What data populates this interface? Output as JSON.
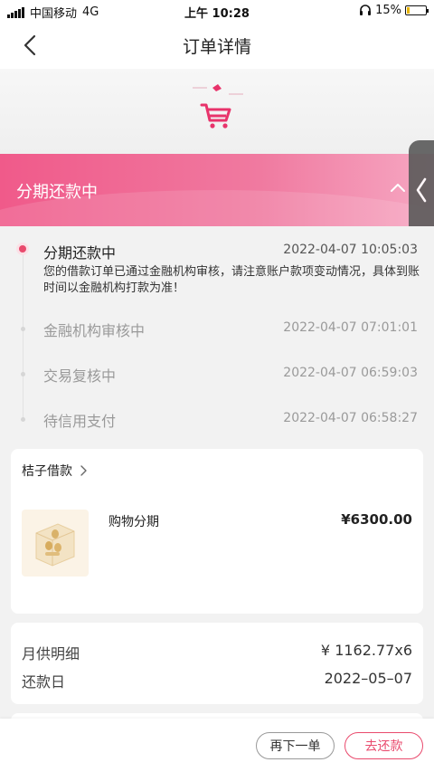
{
  "status_bar": {
    "carrier": "中国移动",
    "network": "4G",
    "time": "上午 10:28",
    "battery_percent": "15%",
    "battery_level": 0.15
  },
  "nav": {
    "title": "订单详情",
    "back_icon": "chevron-left-icon"
  },
  "hero": {
    "icon": "shopping-cart-icon",
    "accent_color": "#e8336b"
  },
  "status_banner": {
    "label": "分期还款中",
    "toggle_icon": "chevron-up-icon",
    "gradient": [
      "#f05a8a",
      "#f6a7c2"
    ]
  },
  "side_handle": {
    "icon": "chevron-left-icon"
  },
  "timeline": {
    "current": {
      "title": "分期还款中",
      "time": "2022-04-07 10:05:03",
      "description": "您的借款订单已通过金融机构审核，请注意账户款项变动情况，具体到账时间以金融机构打款为准！"
    },
    "history": [
      {
        "title": "金融机构审核中",
        "time": "2022-04-07 07:01:01"
      },
      {
        "title": "交易复核中",
        "time": "2022-04-07 06:59:03"
      },
      {
        "title": "待信用支付",
        "time": "2022-04-07 06:58:27"
      }
    ]
  },
  "product_card": {
    "merchant": "桔子借款",
    "merchant_icon": "chevron-right-icon",
    "product_name": "购物分期",
    "price": "¥6300.00",
    "thumbnail_icon": "coins-box-icon"
  },
  "detail_card": {
    "monthly_label": "月供明细",
    "monthly_value": "¥ 1162.77x6",
    "due_label": "还款日",
    "due_value": "2022–05–07"
  },
  "bottom_bar": {
    "reorder_label": "再下一单",
    "repay_label": "去还款",
    "accent_color": "#e94a6d"
  }
}
